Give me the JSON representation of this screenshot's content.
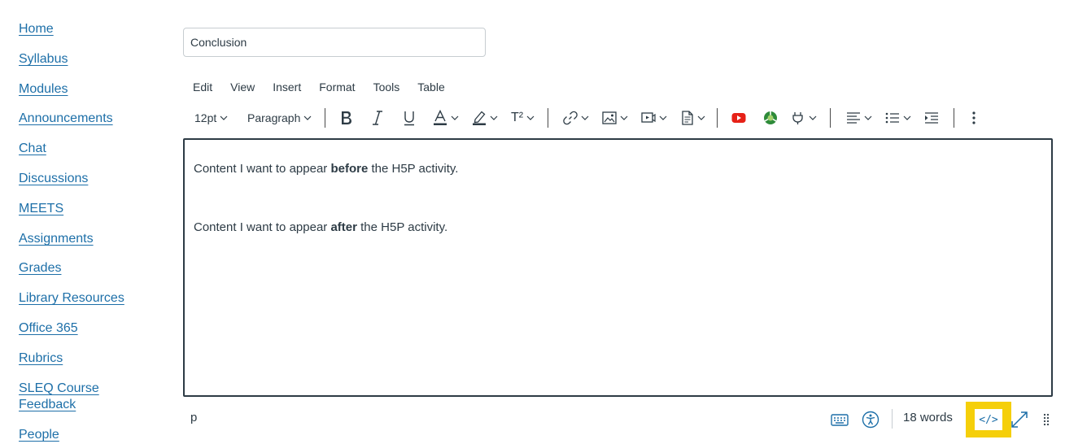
{
  "sidebar": {
    "items": [
      {
        "label": "Home"
      },
      {
        "label": "Syllabus"
      },
      {
        "label": "Modules"
      },
      {
        "label": "Announcements"
      },
      {
        "label": "Chat"
      },
      {
        "label": "Discussions"
      },
      {
        "label": "MEETS"
      },
      {
        "label": "Assignments"
      },
      {
        "label": "Grades"
      },
      {
        "label": "Library Resources"
      },
      {
        "label": "Office 365"
      },
      {
        "label": "Rubrics"
      },
      {
        "label": "SLEQ Course"
      },
      {
        "label": "Feedback"
      },
      {
        "label": "People"
      }
    ]
  },
  "title_input": {
    "value": "Conclusion"
  },
  "menubar": {
    "items": [
      "Edit",
      "View",
      "Insert",
      "Format",
      "Tools",
      "Table"
    ]
  },
  "toolbar": {
    "font_size": "12pt",
    "block_format": "Paragraph",
    "superscript_label": "T²",
    "icons": [
      "bold-icon",
      "italic-icon",
      "underline-icon",
      "text-color-icon",
      "highlight-icon",
      "superscript-icon",
      "link-icon",
      "image-icon",
      "media-icon",
      "document-icon",
      "youtube-icon",
      "app-icon",
      "plugin-icon",
      "align-icon",
      "list-icon",
      "indent-icon",
      "more-icon"
    ]
  },
  "editor": {
    "p1": {
      "before": "Content I want to appear ",
      "bold": "before",
      "after": " the H5P activity."
    },
    "p2": {
      "before": "Content I want to appear ",
      "bold": "after",
      "after": " the H5P activity."
    }
  },
  "statusbar": {
    "path": "p",
    "word_count": "18 words",
    "html_editor_label": "</>",
    "icons": [
      "keyboard-icon",
      "accessibility-icon",
      "fullscreen-icon",
      "resize-handle-icon"
    ]
  },
  "colors": {
    "link": "#1d6fa8",
    "highlight_box": "#f5cf0a",
    "text": "#2d3b45",
    "youtube": "#e62117",
    "app_green": "#2e8b3a"
  }
}
